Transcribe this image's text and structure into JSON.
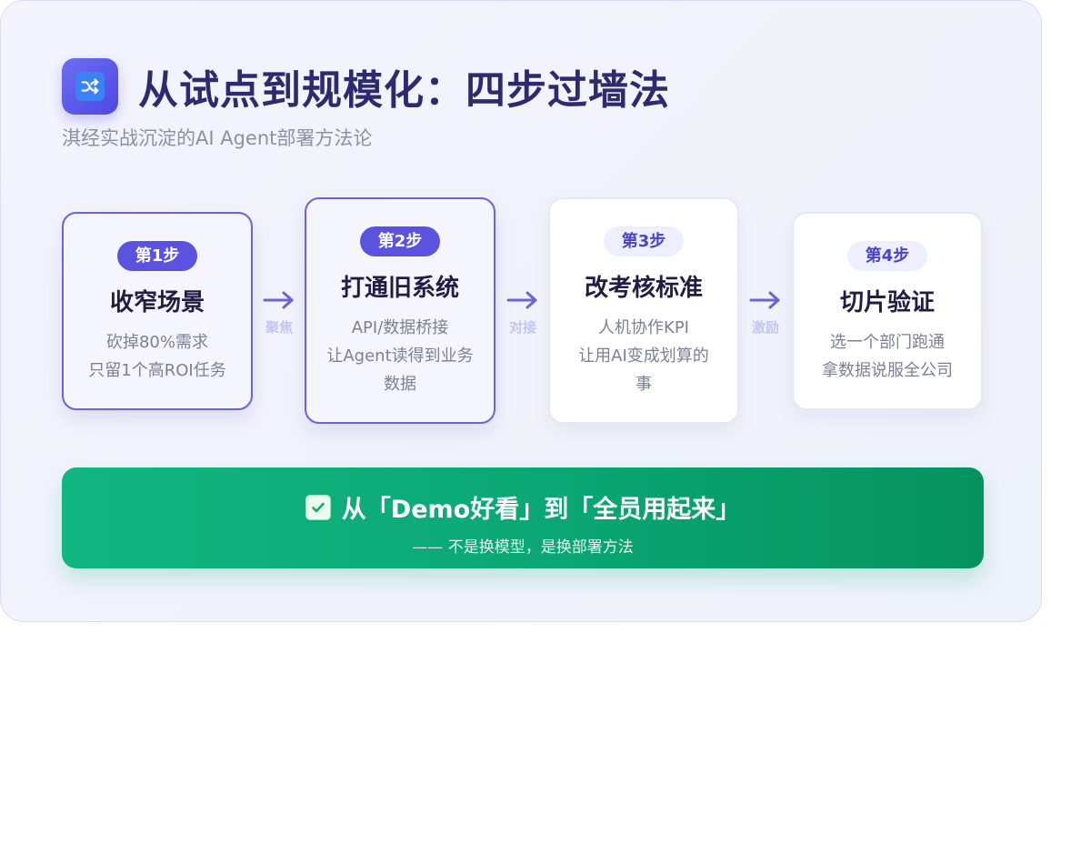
{
  "header": {
    "title": "从试点到规模化：四步过墙法",
    "subtitle": "淇经实战沉淀的AI Agent部署方法论",
    "logo_icon": "shuffle-icon"
  },
  "steps": [
    {
      "badge": "第1步",
      "title": "收窄场景",
      "lines": [
        "砍掉80%需求",
        "只留1个高ROI任务"
      ]
    },
    {
      "badge": "第2步",
      "title": "打通旧系统",
      "lines": [
        "API/数据桥接",
        "让Agent读得到业务",
        "数据"
      ]
    },
    {
      "badge": "第3步",
      "title": "改考核标准",
      "lines": [
        "人机协作KPI",
        "让用AI变成划算的",
        "事"
      ]
    },
    {
      "badge": "第4步",
      "title": "切片验证",
      "lines": [
        "选一个部门跑通",
        "拿数据说服全公司"
      ]
    }
  ],
  "connectors": [
    {
      "label": "聚焦"
    },
    {
      "label": "对接"
    },
    {
      "label": "激励"
    }
  ],
  "banner": {
    "icon": "check-icon",
    "title": "从「Demo好看」到「全员用起来」",
    "subtitle": "—— 不是换模型，是换部署方法"
  },
  "colors": {
    "accent": "#5b52e0",
    "title": "#2e2a70",
    "banner_green": "#0aa673"
  }
}
